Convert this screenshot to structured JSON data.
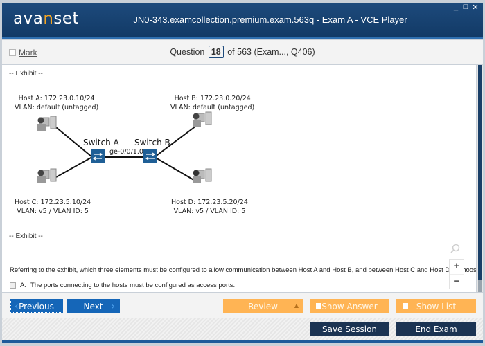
{
  "window": {
    "logo": {
      "prefix": "ava",
      "accent": "n",
      "suffix": "set"
    },
    "title": "JN0-343.examcollection.premium.exam.563q - Exam A - VCE Player",
    "controls": [
      "_",
      "□",
      "✕"
    ]
  },
  "question_bar": {
    "mark_label": "Mark",
    "question_prefix": "Question",
    "question_number": "18",
    "question_suffix": "of 563 (Exam..., Q406)"
  },
  "exhibit": {
    "start_label": "-- Exhibit --",
    "end_label": "-- Exhibit --",
    "hosts": [
      {
        "name": "Host A",
        "line1": "Host A: 172.23.0.10/24",
        "line2": "VLAN: default (untagged)"
      },
      {
        "name": "Host B",
        "line1": "Host B: 172.23.0.20/24",
        "line2": "VLAN: default (untagged)"
      },
      {
        "name": "Host C",
        "line1": "Host C: 172.23.5.10/24",
        "line2": "VLAN: v5 / VLAN ID: 5"
      },
      {
        "name": "Host D",
        "line1": "Host D: 172.23.5.20/24",
        "line2": "VLAN: v5 / VLAN ID: 5"
      }
    ],
    "switches": [
      {
        "label": "Switch A"
      },
      {
        "label": "Switch B"
      }
    ],
    "link_label": "ge-0/0/1.0",
    "colors": {
      "switch": "#1f5f96",
      "link": "#111111",
      "host": "#8a8a8a"
    }
  },
  "question": {
    "text": "Referring to the exhibit, which three elements must be configured to allow communication between Host A and Host B, and between Host C and Host D? (Choose th",
    "options": [
      {
        "letter": "A.",
        "text": "The ports connecting to the hosts must be configured as access ports.",
        "checked": false
      }
    ]
  },
  "zoom_tools": {
    "search_icon": "magnifier",
    "zoom_in": "+",
    "zoom_out": "−"
  },
  "nav": {
    "previous_label": "Previous",
    "next_label": "Next",
    "review_label": "Review",
    "show_answer_label": "Show Answer",
    "show_list_label": "Show List"
  },
  "footer": {
    "save_session_label": "Save Session",
    "end_exam_label": "End Exam"
  },
  "colors": {
    "titlebar": "#123a66",
    "primary_blue": "#1566b8",
    "orange": "#ffb454",
    "dark_navy": "#1b3352"
  }
}
